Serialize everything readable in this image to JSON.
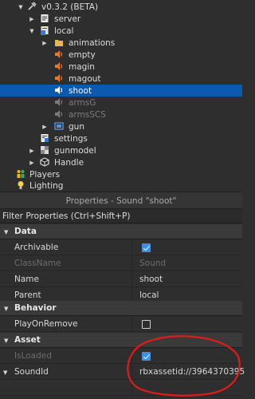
{
  "explorer": {
    "items": [
      {
        "label": "v0.3.2 (BETA)",
        "icon": "tool-icon",
        "arrow": "down",
        "depth": 0
      },
      {
        "label": "server",
        "icon": "script-icon",
        "arrow": "right",
        "depth": 1
      },
      {
        "label": "local",
        "icon": "localscript-icon",
        "arrow": "down",
        "depth": 1
      },
      {
        "label": "animations",
        "icon": "folder-icon",
        "arrow": "right",
        "depth": 2
      },
      {
        "label": "empty",
        "icon": "sound-icon",
        "arrow": "none",
        "depth": 2
      },
      {
        "label": "magin",
        "icon": "sound-icon",
        "arrow": "none",
        "depth": 2
      },
      {
        "label": "magout",
        "icon": "sound-icon",
        "arrow": "none",
        "depth": 2
      },
      {
        "label": "shoot",
        "icon": "sound-icon",
        "arrow": "none",
        "depth": 2,
        "selected": true
      },
      {
        "label": "armsG",
        "icon": "sound-icon",
        "arrow": "none",
        "depth": 2,
        "dim": true
      },
      {
        "label": "armsSCS",
        "icon": "sound-icon",
        "arrow": "none",
        "depth": 2,
        "dim": true
      },
      {
        "label": "gun",
        "icon": "screengui-icon",
        "arrow": "right",
        "depth": 2
      },
      {
        "label": "settings",
        "icon": "modulescript-icon",
        "arrow": "none",
        "depth": 1
      },
      {
        "label": "gunmodel",
        "icon": "model-icon",
        "arrow": "right",
        "depth": 1
      },
      {
        "label": "Handle",
        "icon": "part-icon",
        "arrow": "right",
        "depth": 1
      },
      {
        "label": "Players",
        "icon": "players-icon",
        "arrow": "none",
        "depth": -1
      },
      {
        "label": "Lighting",
        "icon": "lighting-icon",
        "arrow": "none",
        "depth": -1
      }
    ]
  },
  "properties": {
    "header": "Properties - Sound \"shoot\"",
    "filter_placeholder": "Filter Properties (Ctrl+Shift+P)",
    "categories": {
      "data": "Data",
      "behavior": "Behavior",
      "asset": "Asset"
    },
    "rows": {
      "archivable": {
        "name": "Archivable",
        "checked": true
      },
      "classname": {
        "name": "ClassName",
        "value": "Sound"
      },
      "name": {
        "name": "Name",
        "value": "shoot"
      },
      "parent": {
        "name": "Parent",
        "value": "local"
      },
      "playonremove": {
        "name": "PlayOnRemove",
        "checked": false
      },
      "isloaded": {
        "name": "IsLoaded",
        "checked": true
      },
      "soundid": {
        "name": "SoundId",
        "value": "rbxassetid://3964370395"
      }
    }
  },
  "colors": {
    "selection": "#0b5aaf",
    "annotation_circle": "#e01b1b",
    "checkbox": "#3f8ee0"
  }
}
